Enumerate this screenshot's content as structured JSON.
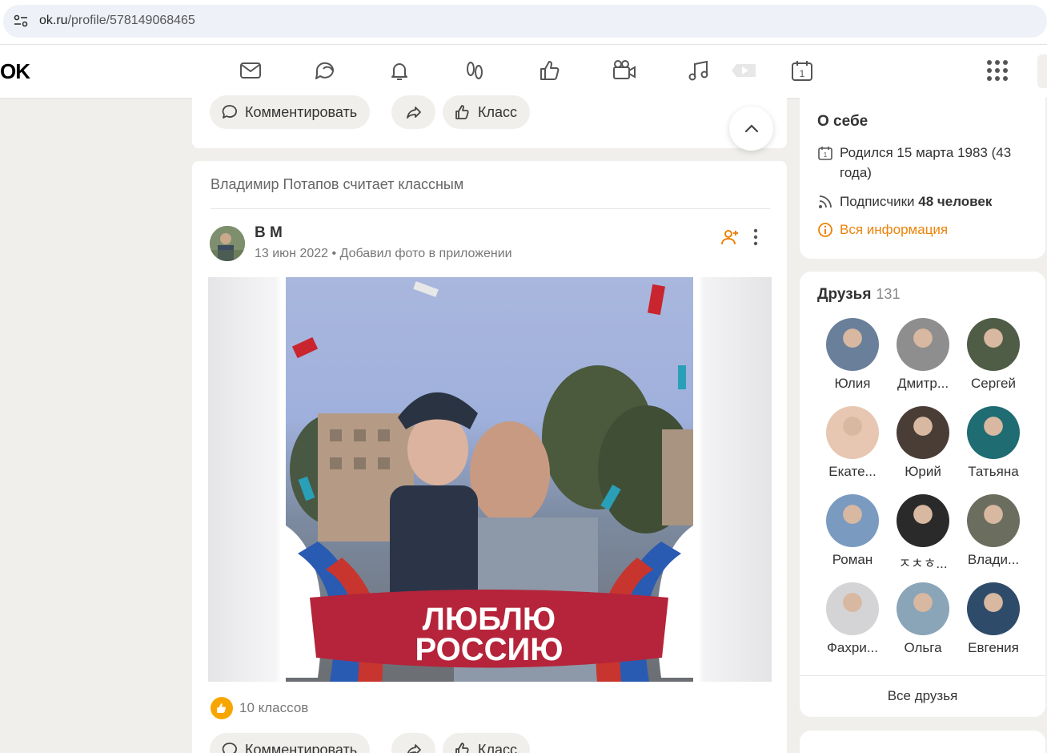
{
  "browser": {
    "url_host": "ok.ru",
    "url_path": "/profile/578149068465"
  },
  "nav": {
    "logo": "OK"
  },
  "top_card": {
    "comment_label": "Комментировать",
    "class_label": "Класс"
  },
  "post": {
    "header": "Владимир Потапов считает классным",
    "author": "В М",
    "date": "13 июн 2022",
    "action": "Добавил фото в приложении",
    "photo_caption_line1": "ЛЮБЛЮ",
    "photo_caption_line2": "РОССИЮ",
    "likes": "10 классов",
    "comment_label": "Комментировать",
    "class_label": "Класс"
  },
  "about": {
    "title": "О себе",
    "birth": "Родился 15 марта 1983 (43 года)",
    "subscribers_label": "Подписчики",
    "subscribers_value": "48 человек",
    "all_info": "Вся информация"
  },
  "friends": {
    "title": "Друзья",
    "count": "131",
    "items": [
      {
        "name": "Юлия",
        "color": "#6a7f9a"
      },
      {
        "name": "Дмитр...",
        "color": "#8e8e8e"
      },
      {
        "name": "Сергей",
        "color": "#4f5c46"
      },
      {
        "name": "Екате...",
        "color": "#e7c7b2"
      },
      {
        "name": "Юрий",
        "color": "#4a3d36"
      },
      {
        "name": "Татьяна",
        "color": "#1f6c72"
      },
      {
        "name": "Роман",
        "color": "#7a9ac0"
      },
      {
        "name": "ㅈㅊㅎ...",
        "color": "#2a2a2a"
      },
      {
        "name": "Влади...",
        "color": "#6b6e5e"
      },
      {
        "name": "Фахри...",
        "color": "#d4d4d6"
      },
      {
        "name": "Ольга",
        "color": "#8aa4b8"
      },
      {
        "name": "Евгения",
        "color": "#2f4b6a"
      }
    ],
    "all_label": "Все друзья"
  },
  "colors": {
    "accent": "#ee8208",
    "like": "#f7a600"
  }
}
